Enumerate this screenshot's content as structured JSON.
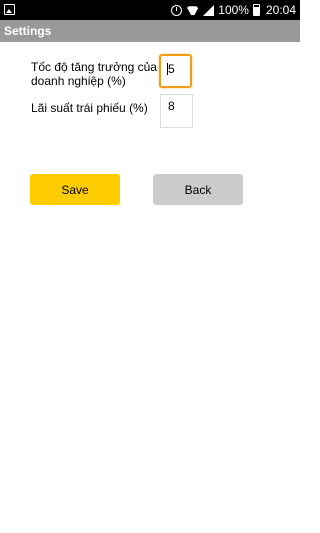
{
  "statusbar": {
    "battery": "100%",
    "time": "20:04"
  },
  "header": {
    "title": "Settings"
  },
  "form": {
    "growth_label": "Tốc độ tăng trưởng của doanh nghiệp (%)",
    "growth_value": "5",
    "bond_label": "Lãi suất trái phiếu (%)",
    "bond_value": "8"
  },
  "buttons": {
    "save": "Save",
    "back": "Back"
  },
  "colors": {
    "accent_focus": "#f29d19",
    "save_bg": "#ffcc00",
    "back_bg": "#cccccc",
    "titlebar_bg": "#999999"
  }
}
